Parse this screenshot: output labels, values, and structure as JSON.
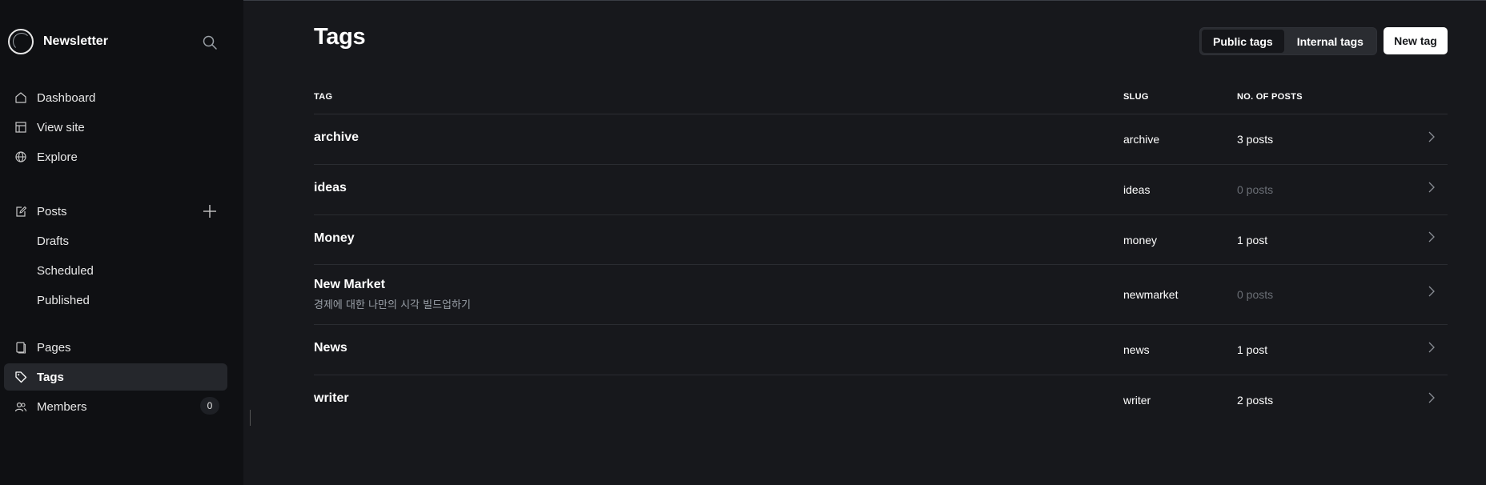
{
  "app": {
    "name": "Newsletter"
  },
  "sidebar": {
    "items": [
      {
        "label": "Dashboard",
        "icon": "home-icon"
      },
      {
        "label": "View site",
        "icon": "layout-icon"
      },
      {
        "label": "Explore",
        "icon": "globe-icon"
      },
      {
        "label": "Posts",
        "icon": "edit-icon"
      },
      {
        "label": "Drafts"
      },
      {
        "label": "Scheduled"
      },
      {
        "label": "Published"
      },
      {
        "label": "Pages",
        "icon": "page-icon"
      },
      {
        "label": "Tags",
        "icon": "tag-icon",
        "active": true
      },
      {
        "label": "Members",
        "icon": "members-icon",
        "count": "0"
      }
    ]
  },
  "main": {
    "title": "Tags",
    "filters": {
      "public": "Public tags",
      "internal": "Internal tags"
    },
    "new_button": "New tag",
    "columns": {
      "tag": "TAG",
      "slug": "SLUG",
      "posts": "NO. OF POSTS"
    },
    "rows": [
      {
        "name": "archive",
        "description": "",
        "slug": "archive",
        "posts": "3 posts"
      },
      {
        "name": "ideas",
        "description": "",
        "slug": "ideas",
        "posts": "0 posts"
      },
      {
        "name": "Money",
        "description": "",
        "slug": "money",
        "posts": "1 post"
      },
      {
        "name": "New Market",
        "description": "경제에 대한 나만의 시각 빌드업하기",
        "slug": "newmarket",
        "posts": "0 posts"
      },
      {
        "name": "News",
        "description": "",
        "slug": "news",
        "posts": "1 post"
      },
      {
        "name": "writer",
        "description": "",
        "slug": "writer",
        "posts": "2 posts"
      }
    ]
  },
  "colors": {
    "background": "#17181c",
    "sidebar": "#0f1013",
    "primary_button": "#ffffff",
    "muted_text": "#6b6f76"
  }
}
